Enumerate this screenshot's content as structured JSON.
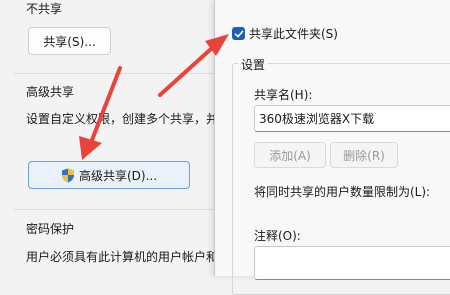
{
  "background_window": {
    "no_share_label": "不共享",
    "share_button": "共享(S)...",
    "advanced_section": "高级共享",
    "advanced_desc": "设置自定义权限，创建多个共享，并",
    "advanced_button": "高级共享(D)...",
    "password_section": "密码保护",
    "password_desc": "用户必须具有此计算机的用户帐户和"
  },
  "dialog": {
    "share_checkbox_label": "共享此文件夹(S)",
    "share_checkbox_checked": true,
    "settings_group": "设置",
    "share_name_label": "共享名(H):",
    "share_name_value": "360极速浏览器X下载",
    "add_button": "添加(A)",
    "remove_button": "删除(R)",
    "limit_label": "将同时共享的用户数量限制为(L):",
    "comment_label": "注释(O):"
  },
  "colors": {
    "accent": "#1e5fb5",
    "arrow": "#e8443a"
  }
}
